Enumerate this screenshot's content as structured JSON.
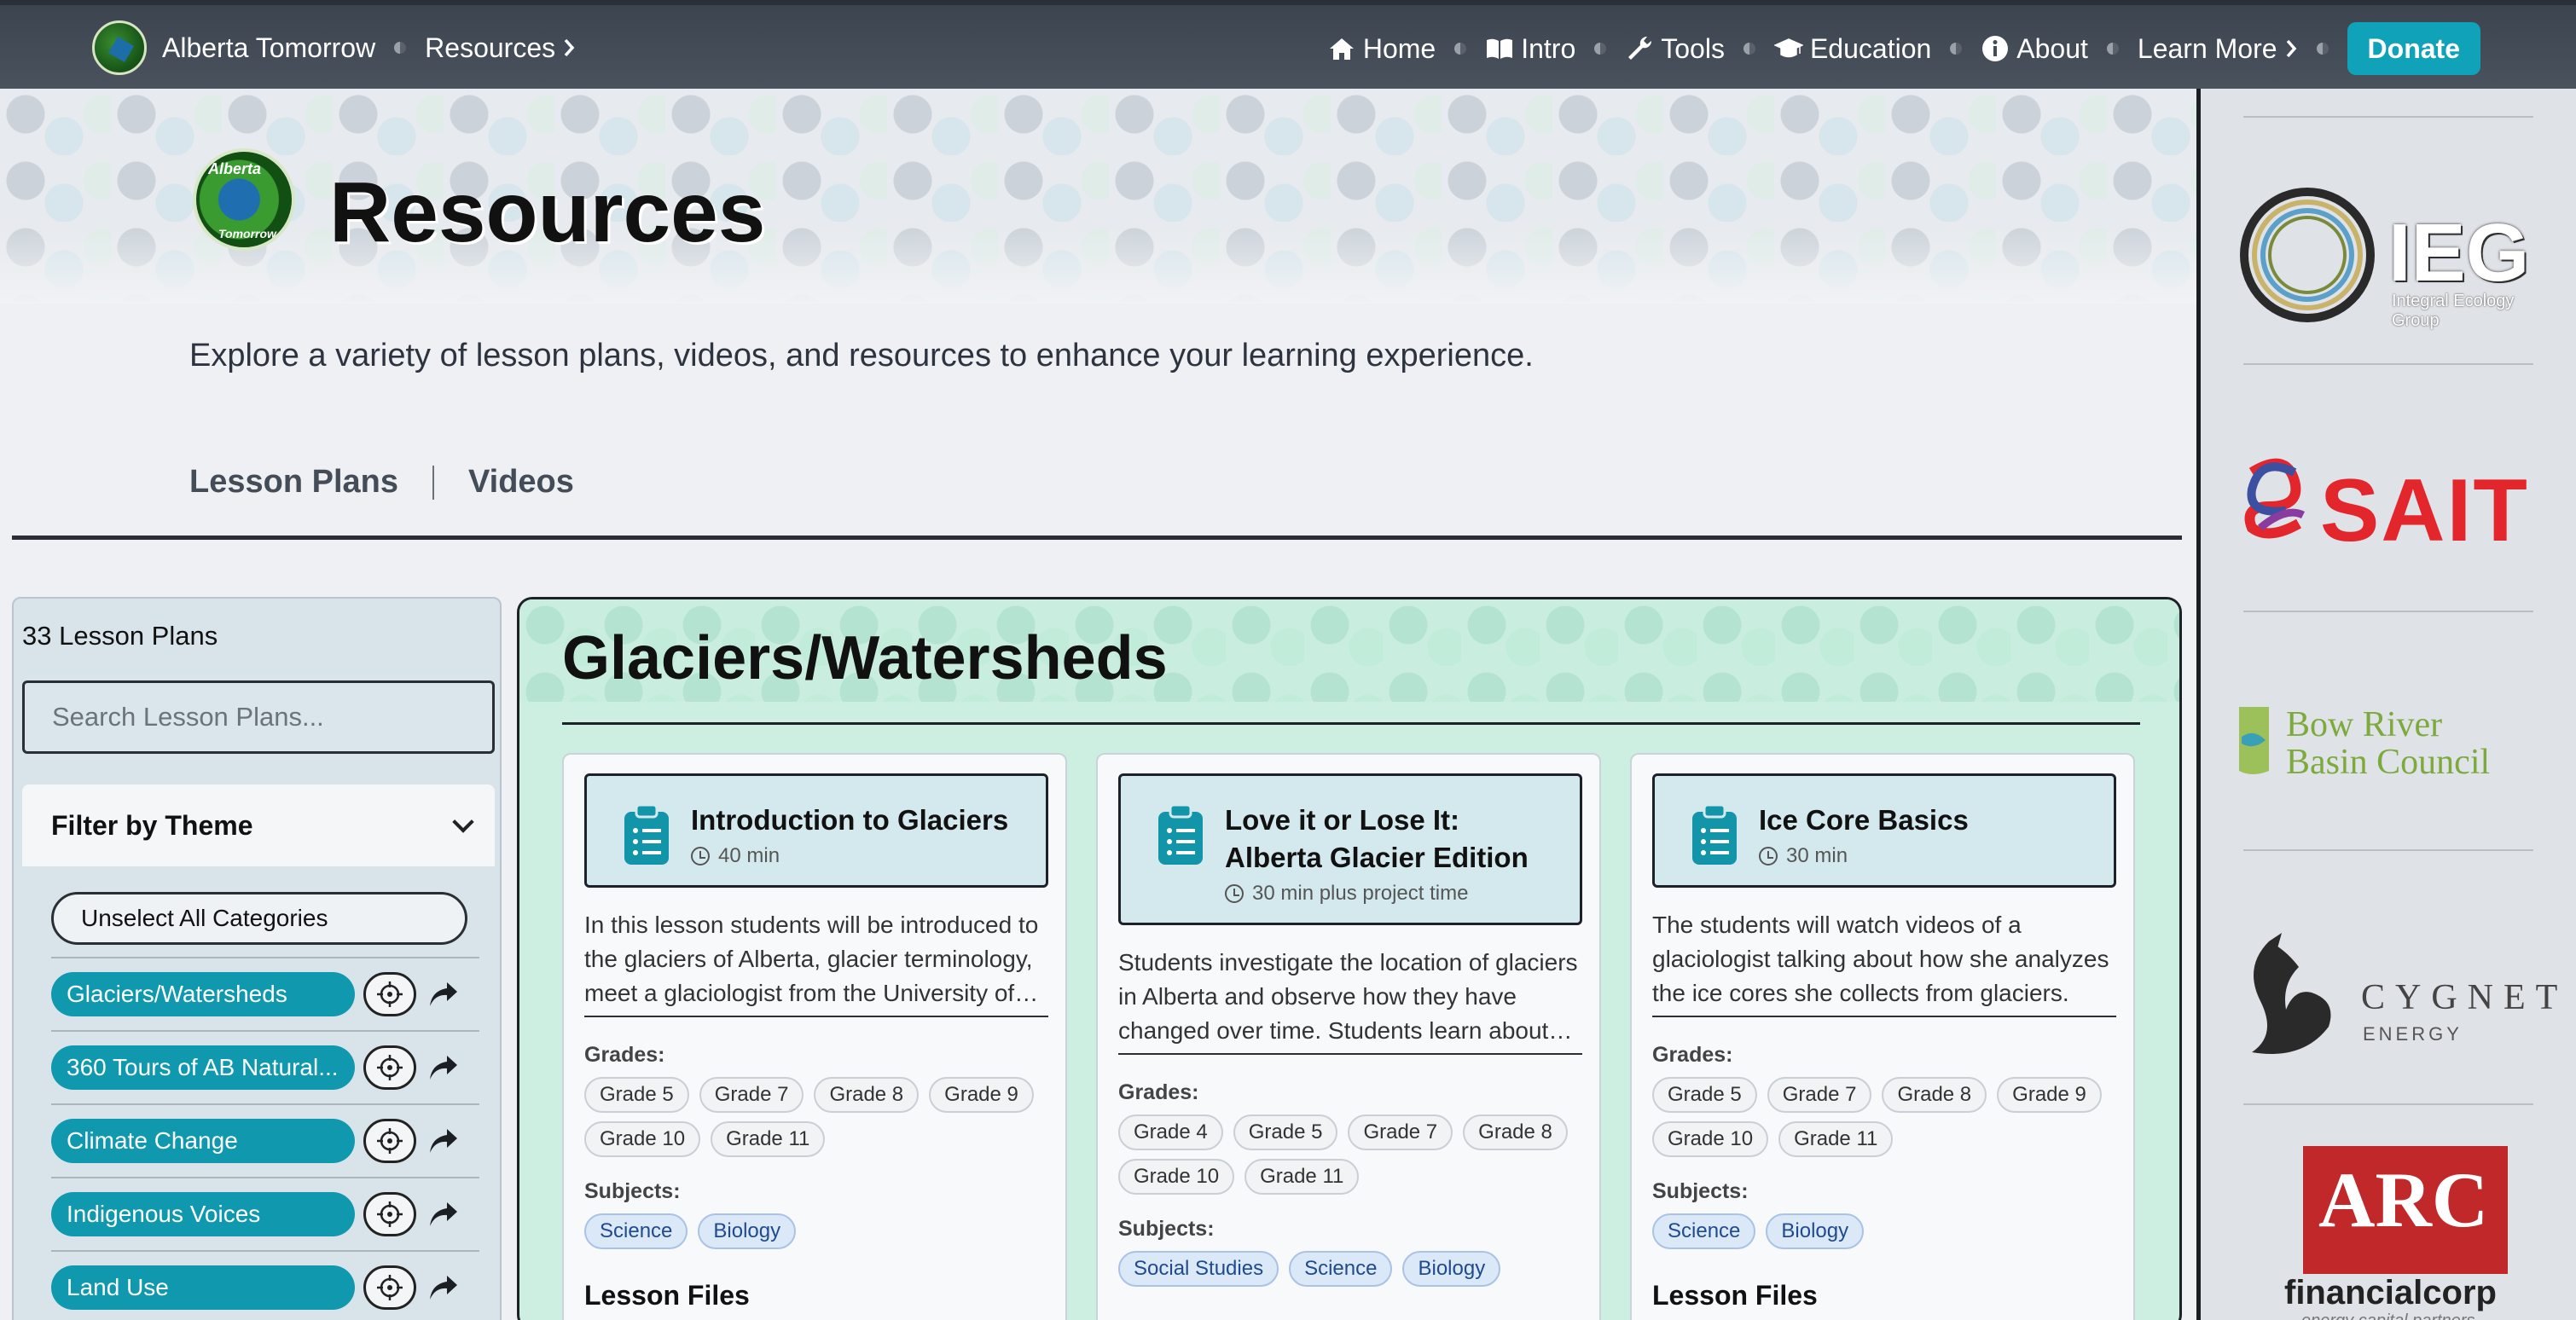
{
  "navbar": {
    "brand": "Alberta Tomorrow",
    "crumb": "Resources",
    "links": [
      {
        "label": "Home",
        "icon": "home-icon"
      },
      {
        "label": "Intro",
        "icon": "book-icon"
      },
      {
        "label": "Tools",
        "icon": "wrench-icon"
      },
      {
        "label": "Education",
        "icon": "graduation-cap-icon"
      },
      {
        "label": "About",
        "icon": "info-icon"
      },
      {
        "label": "Learn More",
        "icon": "chevron-right-icon"
      }
    ],
    "donate": "Donate"
  },
  "hero": {
    "title": "Resources",
    "logo_text_top": "Alberta",
    "logo_text_bottom": "Tomorrow",
    "description": "Explore a variety of lesson plans, videos, and resources to enhance your learning experience."
  },
  "tabs": [
    "Lesson Plans",
    "Videos"
  ],
  "sidebar": {
    "count_label": "33 Lesson Plans",
    "search_placeholder": "Search Lesson Plans...",
    "filter_label": "Filter by Theme",
    "unselect_label": "Unselect All Categories",
    "themes": [
      "Glaciers/Watersheds",
      "360 Tours of AB Natural...",
      "Climate Change",
      "Indigenous Voices",
      "Land Use"
    ]
  },
  "main": {
    "title": "Glaciers/Watersheds",
    "grades_label": "Grades:",
    "subjects_label": "Subjects:",
    "files_label": "Lesson Files",
    "cards": [
      {
        "title": "Introduction to Glaciers",
        "duration": "40 min",
        "description": "In this lesson students will be introduced to the glaciers of Alberta, glacier terminology, meet a glaciologist from the University of…",
        "grades": [
          "Grade 5",
          "Grade 7",
          "Grade 8",
          "Grade 9",
          "Grade 10",
          "Grade 11"
        ],
        "subjects": [
          "Science",
          "Biology"
        ]
      },
      {
        "title": "Love it or Lose It: Alberta Glacier Edition",
        "duration": "30 min plus project time",
        "description": "Students investigate the location of glaciers in Alberta and observe how they have changed over time. Students learn about…",
        "grades": [
          "Grade 4",
          "Grade 5",
          "Grade 7",
          "Grade 8",
          "Grade 10",
          "Grade 11"
        ],
        "subjects": [
          "Social Studies",
          "Science",
          "Biology"
        ]
      },
      {
        "title": "Ice Core Basics",
        "duration": "30 min",
        "description": "The students will watch videos of a glaciologist talking about how she analyzes the ice cores she collects from glaciers.",
        "grades": [
          "Grade 5",
          "Grade 7",
          "Grade 8",
          "Grade 9",
          "Grade 10",
          "Grade 11"
        ],
        "subjects": [
          "Science",
          "Biology"
        ]
      }
    ]
  },
  "sponsors": {
    "ieg": {
      "name": "IEG",
      "sub": "Integral Ecology Group"
    },
    "sait": {
      "name": "SAIT"
    },
    "bow": {
      "line1": "Bow River",
      "line2": "Basin Council"
    },
    "cygnet": {
      "name": "CYGNET",
      "sub": "ENERGY"
    },
    "arc": {
      "name": "ARC",
      "sub": "financialcorp",
      "tag": "energy capital partners"
    }
  },
  "colors": {
    "accent": "#0fa2b8",
    "navbar": "#434b56",
    "sait_red": "#e2262c",
    "arc_red": "#c0282a"
  }
}
